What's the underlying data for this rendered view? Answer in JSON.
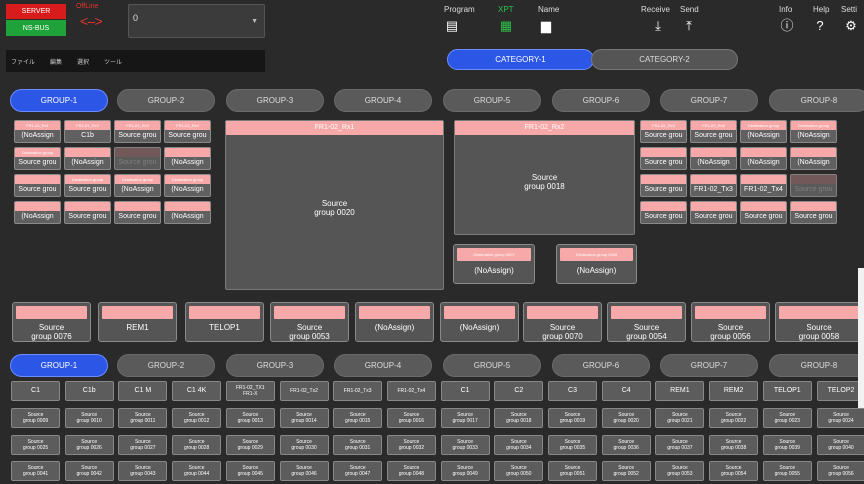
{
  "header": {
    "server": "SERVER",
    "nsbus": "NS-BUS",
    "offline": "OffLine",
    "arrows": "<-->",
    "combo_value": "0"
  },
  "toolbar": {
    "program": "Program",
    "xpt": "XPT",
    "name": "Name",
    "receive": "Receive",
    "send": "Send",
    "info": "Info",
    "help": "Help",
    "settings": "Setti"
  },
  "menu": [
    "ファイル",
    "編集",
    "選択",
    "ツール"
  ],
  "categories": [
    {
      "label": "CATEGORY-1",
      "active": true
    },
    {
      "label": "CATEGORY-2",
      "active": false
    }
  ],
  "groups": [
    "GROUP-1",
    "GROUP-2",
    "GROUP-3",
    "GROUP-4",
    "GROUP-5",
    "GROUP-6",
    "GROUP-7",
    "GROUP-8"
  ],
  "left_grid": [
    [
      {
        "p": "FR1-01_Rx1",
        "t": "(NoAssign"
      },
      {
        "p": "FR1-01_Rx2",
        "t": "C1b"
      },
      {
        "p": "FR1-01_Rx3",
        "t": "Source grou"
      },
      {
        "p": "FR1-01_Rx4",
        "t": "Source grou"
      }
    ],
    [
      {
        "p": "Destination group",
        "t": "Source grou"
      },
      {
        "p": "",
        "t": "(NoAssign"
      },
      {
        "p": "",
        "t": "Source grou",
        "d": true
      },
      {
        "p": "",
        "t": "(NoAssign"
      }
    ],
    [
      {
        "p": "",
        "t": "Source grou"
      },
      {
        "p": "Destination group",
        "t": "Source grou"
      },
      {
        "p": "Destination group",
        "t": "(NoAssign"
      },
      {
        "p": "Destination group",
        "t": "(NoAssign"
      }
    ],
    [
      {
        "p": "",
        "t": "(NoAssign"
      },
      {
        "p": "",
        "t": "Source grou"
      },
      {
        "p": "",
        "t": "Source grou"
      },
      {
        "p": "",
        "t": "(NoAssign"
      }
    ]
  ],
  "right_grid": [
    [
      {
        "p": "FR1-02_Rx5",
        "t": "Source grou"
      },
      {
        "p": "FR1-02_Rx6",
        "t": "Source grou"
      },
      {
        "p": "Destination group",
        "t": "(NoAssign"
      },
      {
        "p": "Destination group",
        "t": "(NoAssign"
      }
    ],
    [
      {
        "p": "",
        "t": "Source grou"
      },
      {
        "p": "",
        "t": "(NoAssign"
      },
      {
        "p": "",
        "t": "(NoAssign"
      },
      {
        "p": "",
        "t": "(NoAssign"
      }
    ],
    [
      {
        "p": "",
        "t": "Source grou"
      },
      {
        "p": "",
        "t": "FR1-02_Tx3"
      },
      {
        "p": "",
        "t": "FR1-02_Tx4"
      },
      {
        "p": "",
        "t": "Source grou",
        "d": true
      }
    ],
    [
      {
        "p": "",
        "t": "Source grou"
      },
      {
        "p": "",
        "t": "Source grou"
      },
      {
        "p": "",
        "t": "Source grou"
      },
      {
        "p": "",
        "t": "Source grou"
      }
    ]
  ],
  "big_panels": [
    {
      "title": "FR1-02_Rx1",
      "text": "Source\ngroup 0020"
    },
    {
      "title": "FR1-02_Rx2",
      "text": "Source\ngroup 0018"
    }
  ],
  "mid_panels": [
    {
      "title": "Destination group 0007",
      "text": "(NoAssign)"
    },
    {
      "title": "Destination group 0008",
      "text": "(NoAssign)"
    }
  ],
  "strip": [
    "Source\ngroup 0076",
    "REM1",
    "TELOP1",
    "Source\ngroup 0053",
    "(NoAssign)",
    "(NoAssign)",
    "Source\ngroup 0070",
    "Source\ngroup 0054",
    "Source\ngroup 0056",
    "Source\ngroup 0058"
  ],
  "src_row1": [
    "C1",
    "C1b",
    "C1 M",
    "C1 4K",
    "FR1-02_TX1\nFR1-X",
    "FR1-02_Tx2",
    "FR1-02_Tx3",
    "FR1-02_Tx4",
    "C1",
    "C2",
    "C3",
    "C4",
    "REM1",
    "REM2",
    "TELOP1",
    "TELOP2"
  ],
  "src_row2": [
    "0009",
    "0010",
    "0011",
    "0012",
    "0013",
    "0014",
    "0015",
    "0016",
    "0017",
    "0018",
    "0019",
    "0020",
    "0021",
    "0022",
    "0023",
    "0024"
  ],
  "src_row3": [
    "0025",
    "0026",
    "0027",
    "0028",
    "0029",
    "0030",
    "0031",
    "0032",
    "0033",
    "0034",
    "0035",
    "0036",
    "0037",
    "0038",
    "0039",
    "0040"
  ],
  "src_row4": [
    "0041",
    "0042",
    "0043",
    "0044",
    "0045",
    "0046",
    "0047",
    "0048",
    "0049",
    "0050",
    "0051",
    "0052",
    "0053",
    "0054",
    "0055",
    "0056"
  ],
  "src_prefix": "Source\ngroup ",
  "colors": {
    "accent": "#2c56e6",
    "pink": "#f7a8a8",
    "server": "#d81b1b",
    "nsbus": "#1fa23a",
    "offline": "#e0362a",
    "xpt": "#2ec04a"
  },
  "icons": {
    "program": "document-list-icon",
    "xpt": "grid-icon",
    "name": "document-icon",
    "receive": "download-icon",
    "send": "upload-icon",
    "info": "info-icon",
    "help": "help-icon",
    "settings": "gear-icon"
  }
}
